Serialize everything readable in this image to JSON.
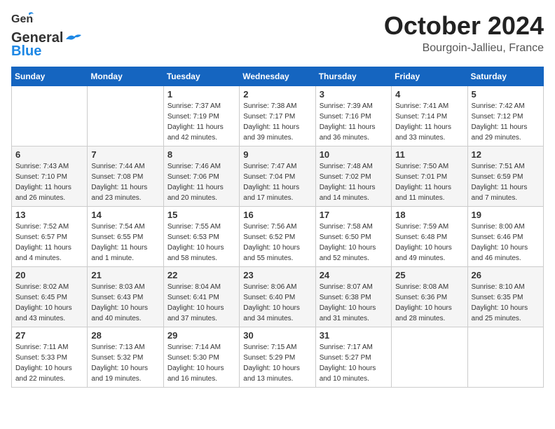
{
  "header": {
    "logo_general": "General",
    "logo_blue": "Blue",
    "month_title": "October 2024",
    "location": "Bourgoin-Jallieu, France"
  },
  "days_of_week": [
    "Sunday",
    "Monday",
    "Tuesday",
    "Wednesday",
    "Thursday",
    "Friday",
    "Saturday"
  ],
  "weeks": [
    [
      {
        "day": "",
        "sunrise": "",
        "sunset": "",
        "daylight": ""
      },
      {
        "day": "",
        "sunrise": "",
        "sunset": "",
        "daylight": ""
      },
      {
        "day": "1",
        "sunrise": "Sunrise: 7:37 AM",
        "sunset": "Sunset: 7:19 PM",
        "daylight": "Daylight: 11 hours and 42 minutes."
      },
      {
        "day": "2",
        "sunrise": "Sunrise: 7:38 AM",
        "sunset": "Sunset: 7:17 PM",
        "daylight": "Daylight: 11 hours and 39 minutes."
      },
      {
        "day": "3",
        "sunrise": "Sunrise: 7:39 AM",
        "sunset": "Sunset: 7:16 PM",
        "daylight": "Daylight: 11 hours and 36 minutes."
      },
      {
        "day": "4",
        "sunrise": "Sunrise: 7:41 AM",
        "sunset": "Sunset: 7:14 PM",
        "daylight": "Daylight: 11 hours and 33 minutes."
      },
      {
        "day": "5",
        "sunrise": "Sunrise: 7:42 AM",
        "sunset": "Sunset: 7:12 PM",
        "daylight": "Daylight: 11 hours and 29 minutes."
      }
    ],
    [
      {
        "day": "6",
        "sunrise": "Sunrise: 7:43 AM",
        "sunset": "Sunset: 7:10 PM",
        "daylight": "Daylight: 11 hours and 26 minutes."
      },
      {
        "day": "7",
        "sunrise": "Sunrise: 7:44 AM",
        "sunset": "Sunset: 7:08 PM",
        "daylight": "Daylight: 11 hours and 23 minutes."
      },
      {
        "day": "8",
        "sunrise": "Sunrise: 7:46 AM",
        "sunset": "Sunset: 7:06 PM",
        "daylight": "Daylight: 11 hours and 20 minutes."
      },
      {
        "day": "9",
        "sunrise": "Sunrise: 7:47 AM",
        "sunset": "Sunset: 7:04 PM",
        "daylight": "Daylight: 11 hours and 17 minutes."
      },
      {
        "day": "10",
        "sunrise": "Sunrise: 7:48 AM",
        "sunset": "Sunset: 7:02 PM",
        "daylight": "Daylight: 11 hours and 14 minutes."
      },
      {
        "day": "11",
        "sunrise": "Sunrise: 7:50 AM",
        "sunset": "Sunset: 7:01 PM",
        "daylight": "Daylight: 11 hours and 11 minutes."
      },
      {
        "day": "12",
        "sunrise": "Sunrise: 7:51 AM",
        "sunset": "Sunset: 6:59 PM",
        "daylight": "Daylight: 11 hours and 7 minutes."
      }
    ],
    [
      {
        "day": "13",
        "sunrise": "Sunrise: 7:52 AM",
        "sunset": "Sunset: 6:57 PM",
        "daylight": "Daylight: 11 hours and 4 minutes."
      },
      {
        "day": "14",
        "sunrise": "Sunrise: 7:54 AM",
        "sunset": "Sunset: 6:55 PM",
        "daylight": "Daylight: 11 hours and 1 minute."
      },
      {
        "day": "15",
        "sunrise": "Sunrise: 7:55 AM",
        "sunset": "Sunset: 6:53 PM",
        "daylight": "Daylight: 10 hours and 58 minutes."
      },
      {
        "day": "16",
        "sunrise": "Sunrise: 7:56 AM",
        "sunset": "Sunset: 6:52 PM",
        "daylight": "Daylight: 10 hours and 55 minutes."
      },
      {
        "day": "17",
        "sunrise": "Sunrise: 7:58 AM",
        "sunset": "Sunset: 6:50 PM",
        "daylight": "Daylight: 10 hours and 52 minutes."
      },
      {
        "day": "18",
        "sunrise": "Sunrise: 7:59 AM",
        "sunset": "Sunset: 6:48 PM",
        "daylight": "Daylight: 10 hours and 49 minutes."
      },
      {
        "day": "19",
        "sunrise": "Sunrise: 8:00 AM",
        "sunset": "Sunset: 6:46 PM",
        "daylight": "Daylight: 10 hours and 46 minutes."
      }
    ],
    [
      {
        "day": "20",
        "sunrise": "Sunrise: 8:02 AM",
        "sunset": "Sunset: 6:45 PM",
        "daylight": "Daylight: 10 hours and 43 minutes."
      },
      {
        "day": "21",
        "sunrise": "Sunrise: 8:03 AM",
        "sunset": "Sunset: 6:43 PM",
        "daylight": "Daylight: 10 hours and 40 minutes."
      },
      {
        "day": "22",
        "sunrise": "Sunrise: 8:04 AM",
        "sunset": "Sunset: 6:41 PM",
        "daylight": "Daylight: 10 hours and 37 minutes."
      },
      {
        "day": "23",
        "sunrise": "Sunrise: 8:06 AM",
        "sunset": "Sunset: 6:40 PM",
        "daylight": "Daylight: 10 hours and 34 minutes."
      },
      {
        "day": "24",
        "sunrise": "Sunrise: 8:07 AM",
        "sunset": "Sunset: 6:38 PM",
        "daylight": "Daylight: 10 hours and 31 minutes."
      },
      {
        "day": "25",
        "sunrise": "Sunrise: 8:08 AM",
        "sunset": "Sunset: 6:36 PM",
        "daylight": "Daylight: 10 hours and 28 minutes."
      },
      {
        "day": "26",
        "sunrise": "Sunrise: 8:10 AM",
        "sunset": "Sunset: 6:35 PM",
        "daylight": "Daylight: 10 hours and 25 minutes."
      }
    ],
    [
      {
        "day": "27",
        "sunrise": "Sunrise: 7:11 AM",
        "sunset": "Sunset: 5:33 PM",
        "daylight": "Daylight: 10 hours and 22 minutes."
      },
      {
        "day": "28",
        "sunrise": "Sunrise: 7:13 AM",
        "sunset": "Sunset: 5:32 PM",
        "daylight": "Daylight: 10 hours and 19 minutes."
      },
      {
        "day": "29",
        "sunrise": "Sunrise: 7:14 AM",
        "sunset": "Sunset: 5:30 PM",
        "daylight": "Daylight: 10 hours and 16 minutes."
      },
      {
        "day": "30",
        "sunrise": "Sunrise: 7:15 AM",
        "sunset": "Sunset: 5:29 PM",
        "daylight": "Daylight: 10 hours and 13 minutes."
      },
      {
        "day": "31",
        "sunrise": "Sunrise: 7:17 AM",
        "sunset": "Sunset: 5:27 PM",
        "daylight": "Daylight: 10 hours and 10 minutes."
      },
      {
        "day": "",
        "sunrise": "",
        "sunset": "",
        "daylight": ""
      },
      {
        "day": "",
        "sunrise": "",
        "sunset": "",
        "daylight": ""
      }
    ]
  ]
}
